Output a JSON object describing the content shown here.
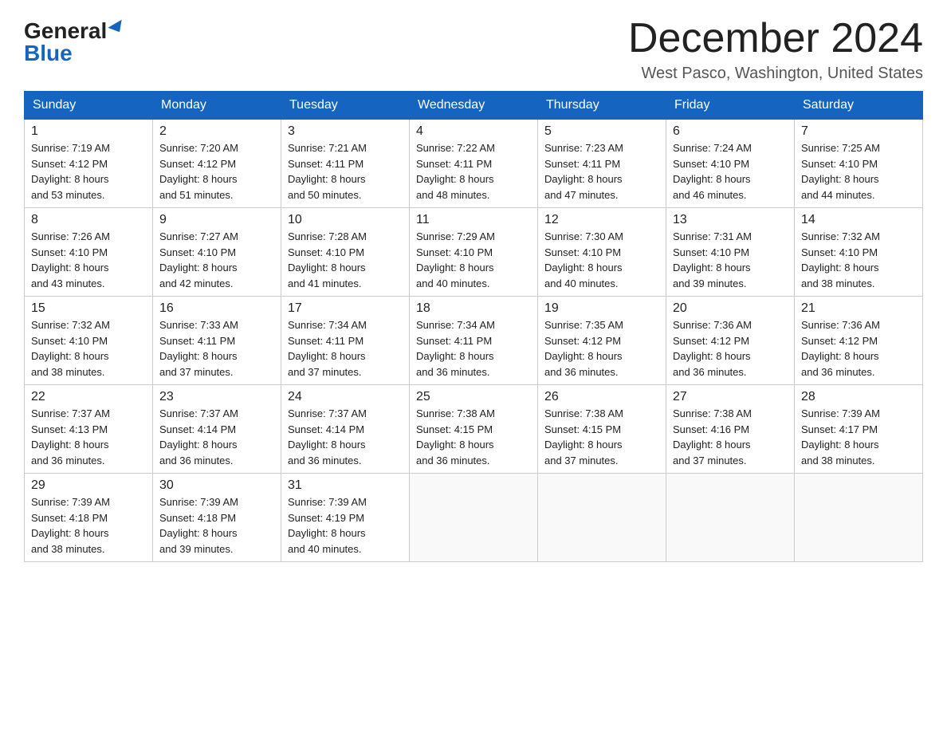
{
  "logo": {
    "general": "General",
    "blue": "Blue"
  },
  "title": "December 2024",
  "subtitle": "West Pasco, Washington, United States",
  "weekdays": [
    "Sunday",
    "Monday",
    "Tuesday",
    "Wednesday",
    "Thursday",
    "Friday",
    "Saturday"
  ],
  "weeks": [
    [
      {
        "day": "1",
        "sunrise": "7:19 AM",
        "sunset": "4:12 PM",
        "daylight": "8 hours and 53 minutes."
      },
      {
        "day": "2",
        "sunrise": "7:20 AM",
        "sunset": "4:12 PM",
        "daylight": "8 hours and 51 minutes."
      },
      {
        "day": "3",
        "sunrise": "7:21 AM",
        "sunset": "4:11 PM",
        "daylight": "8 hours and 50 minutes."
      },
      {
        "day": "4",
        "sunrise": "7:22 AM",
        "sunset": "4:11 PM",
        "daylight": "8 hours and 48 minutes."
      },
      {
        "day": "5",
        "sunrise": "7:23 AM",
        "sunset": "4:11 PM",
        "daylight": "8 hours and 47 minutes."
      },
      {
        "day": "6",
        "sunrise": "7:24 AM",
        "sunset": "4:10 PM",
        "daylight": "8 hours and 46 minutes."
      },
      {
        "day": "7",
        "sunrise": "7:25 AM",
        "sunset": "4:10 PM",
        "daylight": "8 hours and 44 minutes."
      }
    ],
    [
      {
        "day": "8",
        "sunrise": "7:26 AM",
        "sunset": "4:10 PM",
        "daylight": "8 hours and 43 minutes."
      },
      {
        "day": "9",
        "sunrise": "7:27 AM",
        "sunset": "4:10 PM",
        "daylight": "8 hours and 42 minutes."
      },
      {
        "day": "10",
        "sunrise": "7:28 AM",
        "sunset": "4:10 PM",
        "daylight": "8 hours and 41 minutes."
      },
      {
        "day": "11",
        "sunrise": "7:29 AM",
        "sunset": "4:10 PM",
        "daylight": "8 hours and 40 minutes."
      },
      {
        "day": "12",
        "sunrise": "7:30 AM",
        "sunset": "4:10 PM",
        "daylight": "8 hours and 40 minutes."
      },
      {
        "day": "13",
        "sunrise": "7:31 AM",
        "sunset": "4:10 PM",
        "daylight": "8 hours and 39 minutes."
      },
      {
        "day": "14",
        "sunrise": "7:32 AM",
        "sunset": "4:10 PM",
        "daylight": "8 hours and 38 minutes."
      }
    ],
    [
      {
        "day": "15",
        "sunrise": "7:32 AM",
        "sunset": "4:10 PM",
        "daylight": "8 hours and 38 minutes."
      },
      {
        "day": "16",
        "sunrise": "7:33 AM",
        "sunset": "4:11 PM",
        "daylight": "8 hours and 37 minutes."
      },
      {
        "day": "17",
        "sunrise": "7:34 AM",
        "sunset": "4:11 PM",
        "daylight": "8 hours and 37 minutes."
      },
      {
        "day": "18",
        "sunrise": "7:34 AM",
        "sunset": "4:11 PM",
        "daylight": "8 hours and 36 minutes."
      },
      {
        "day": "19",
        "sunrise": "7:35 AM",
        "sunset": "4:12 PM",
        "daylight": "8 hours and 36 minutes."
      },
      {
        "day": "20",
        "sunrise": "7:36 AM",
        "sunset": "4:12 PM",
        "daylight": "8 hours and 36 minutes."
      },
      {
        "day": "21",
        "sunrise": "7:36 AM",
        "sunset": "4:12 PM",
        "daylight": "8 hours and 36 minutes."
      }
    ],
    [
      {
        "day": "22",
        "sunrise": "7:37 AM",
        "sunset": "4:13 PM",
        "daylight": "8 hours and 36 minutes."
      },
      {
        "day": "23",
        "sunrise": "7:37 AM",
        "sunset": "4:14 PM",
        "daylight": "8 hours and 36 minutes."
      },
      {
        "day": "24",
        "sunrise": "7:37 AM",
        "sunset": "4:14 PM",
        "daylight": "8 hours and 36 minutes."
      },
      {
        "day": "25",
        "sunrise": "7:38 AM",
        "sunset": "4:15 PM",
        "daylight": "8 hours and 36 minutes."
      },
      {
        "day": "26",
        "sunrise": "7:38 AM",
        "sunset": "4:15 PM",
        "daylight": "8 hours and 37 minutes."
      },
      {
        "day": "27",
        "sunrise": "7:38 AM",
        "sunset": "4:16 PM",
        "daylight": "8 hours and 37 minutes."
      },
      {
        "day": "28",
        "sunrise": "7:39 AM",
        "sunset": "4:17 PM",
        "daylight": "8 hours and 38 minutes."
      }
    ],
    [
      {
        "day": "29",
        "sunrise": "7:39 AM",
        "sunset": "4:18 PM",
        "daylight": "8 hours and 38 minutes."
      },
      {
        "day": "30",
        "sunrise": "7:39 AM",
        "sunset": "4:18 PM",
        "daylight": "8 hours and 39 minutes."
      },
      {
        "day": "31",
        "sunrise": "7:39 AM",
        "sunset": "4:19 PM",
        "daylight": "8 hours and 40 minutes."
      },
      null,
      null,
      null,
      null
    ]
  ],
  "labels": {
    "sunrise": "Sunrise:",
    "sunset": "Sunset:",
    "daylight": "Daylight:"
  }
}
